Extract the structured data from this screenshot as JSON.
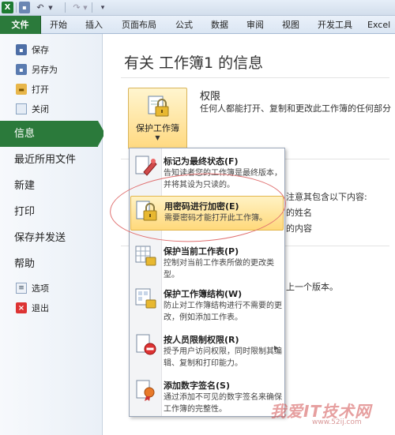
{
  "quick_access": {
    "app_icon": "X",
    "save_icon": "floppy-icon",
    "undo_icon": "undo-icon",
    "redo_icon": "redo-icon"
  },
  "ribbon_tabs": [
    "文件",
    "开始",
    "插入",
    "页面布局",
    "公式",
    "数据",
    "审阅",
    "视图",
    "开发工具",
    "Excel"
  ],
  "backstage": {
    "commands_top": [
      "保存",
      "另存为",
      "打开",
      "关闭"
    ],
    "tabs": [
      "信息",
      "最近所用文件",
      "新建",
      "打印",
      "保存并发送",
      "帮助"
    ],
    "commands_bottom": [
      "选项",
      "退出"
    ],
    "active_tab": "信息"
  },
  "main": {
    "title": "有关 工作簿1 的信息",
    "permissions_button": "保护工作簿",
    "permissions_heading": "权限",
    "permissions_desc": "任何人都能打开、复制和更改此工作簿的任何部分",
    "bg_line1": "注意其包含以下内容:",
    "bg_line2": "的姓名",
    "bg_line3": "的内容",
    "bg_line4": "上一个版本。"
  },
  "menu": {
    "items": [
      {
        "title": "标记为最终状态(F)",
        "desc": "告知读者您的工作簿是最终版本，并将其设为只读的。",
        "icon": "final-stamp-icon"
      },
      {
        "title": "用密码进行加密(E)",
        "desc": "需要密码才能打开此工作簿。",
        "icon": "encrypt-lock-icon",
        "highlight": true
      },
      {
        "title": "保护当前工作表(P)",
        "desc": "控制对当前工作表所做的更改类型。",
        "icon": "protect-sheet-icon"
      },
      {
        "title": "保护工作簿结构(W)",
        "desc": "防止对工作簿结构进行不需要的更改，例如添加工作表。",
        "icon": "protect-structure-icon"
      },
      {
        "title": "按人员限制权限(R)",
        "desc": "授予用户访问权限，同时限制其编辑、复制和打印能力。",
        "icon": "restrict-permission-icon",
        "submenu": true
      },
      {
        "title": "添加数字签名(S)",
        "desc": "通过添加不可见的数字签名来确保工作簿的完整性。",
        "icon": "digital-signature-icon"
      }
    ]
  },
  "watermark": {
    "text": "我爱IT技术网",
    "url": "www.52ij.com"
  },
  "colors": {
    "file_tab": "#2b7a3b",
    "highlight": "#ffd97b",
    "annotation": "#e07171"
  }
}
